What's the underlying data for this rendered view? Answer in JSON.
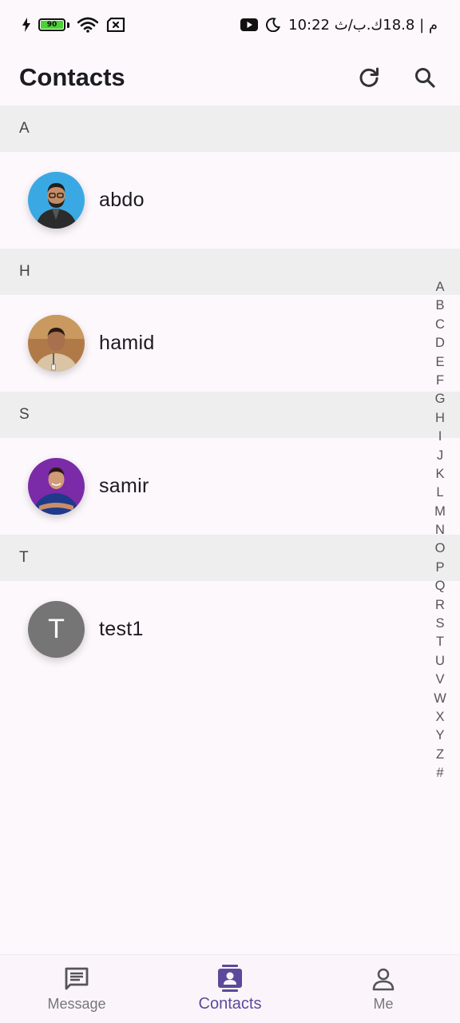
{
  "status_bar": {
    "battery_level": "90",
    "right_text": "10:22 م | 18.8ك.ب/ث"
  },
  "header": {
    "title": "Contacts",
    "refresh_icon": "refresh-icon",
    "search_icon": "search-icon"
  },
  "sections": [
    {
      "letter": "A",
      "contacts": [
        {
          "name": "abdo",
          "avatar": "photo"
        }
      ]
    },
    {
      "letter": "H",
      "contacts": [
        {
          "name": "hamid",
          "avatar": "photo"
        }
      ]
    },
    {
      "letter": "S",
      "contacts": [
        {
          "name": "samir",
          "avatar": "photo"
        }
      ]
    },
    {
      "letter": "T",
      "contacts": [
        {
          "name": "test1",
          "avatar": "letter",
          "initial": "T"
        }
      ]
    }
  ],
  "alphabet_index": [
    "A",
    "B",
    "C",
    "D",
    "E",
    "F",
    "G",
    "H",
    "I",
    "J",
    "K",
    "L",
    "M",
    "N",
    "O",
    "P",
    "Q",
    "R",
    "S",
    "T",
    "U",
    "V",
    "W",
    "X",
    "Y",
    "Z",
    "#"
  ],
  "bottom_nav": {
    "items": [
      {
        "label": "Message",
        "icon": "message-icon",
        "active": false
      },
      {
        "label": "Contacts",
        "icon": "contacts-icon",
        "active": true
      },
      {
        "label": "Me",
        "icon": "person-icon",
        "active": false
      }
    ]
  },
  "colors": {
    "accent": "#5b4a9b",
    "section_bg": "#eeeeee",
    "page_bg": "#fdf8fc"
  }
}
